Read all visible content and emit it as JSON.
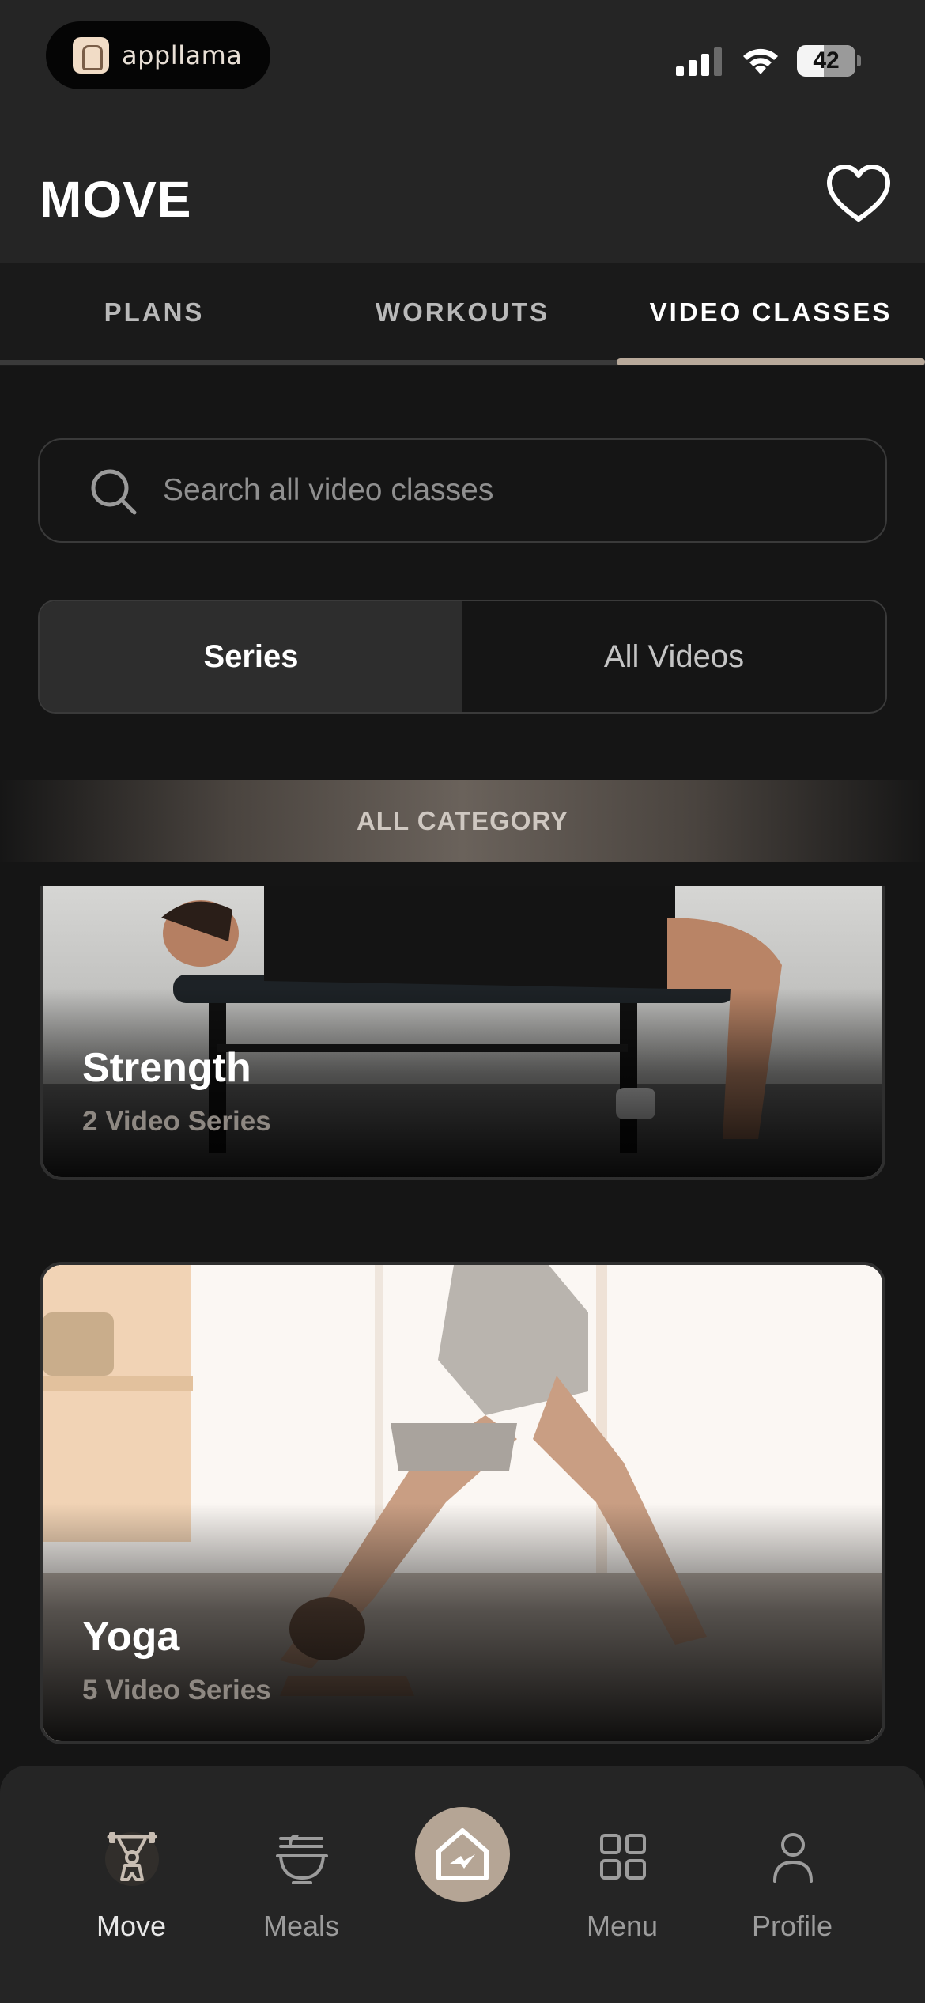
{
  "status_bar": {
    "app_name": "appllama",
    "battery": "42",
    "icons": [
      "cellular-signal-icon",
      "wifi-icon",
      "battery-icon"
    ]
  },
  "header": {
    "title": "MOVE",
    "favorite_icon": "heart-icon"
  },
  "tabs": [
    {
      "label": "PLANS",
      "active": false
    },
    {
      "label": "WORKOUTS",
      "active": false
    },
    {
      "label": "VIDEO CLASSES",
      "active": true
    }
  ],
  "search": {
    "placeholder": "Search all video classes",
    "value": "",
    "icon": "search-icon"
  },
  "segmented": {
    "options": [
      "Series",
      "All Videos"
    ],
    "selected": "Series"
  },
  "category_banner": "ALL CATEGORY",
  "series": [
    {
      "title": "Strength",
      "subtitle": "2 Video Series"
    },
    {
      "title": "Yoga",
      "subtitle": "5 Video Series"
    }
  ],
  "bottom_nav": {
    "items": [
      {
        "label": "Move",
        "icon": "weightlifter-icon",
        "active": true
      },
      {
        "label": "Meals",
        "icon": "noodle-bowl-icon",
        "active": false
      },
      {
        "label": "Menu",
        "icon": "grid-icon",
        "active": false
      },
      {
        "label": "Profile",
        "icon": "person-icon",
        "active": false
      }
    ],
    "center_icon": "home-logo-icon"
  },
  "colors": {
    "background": "#151515",
    "header": "#252525",
    "accent": "#b5a595",
    "tab_indicator": "#b8a99a"
  }
}
